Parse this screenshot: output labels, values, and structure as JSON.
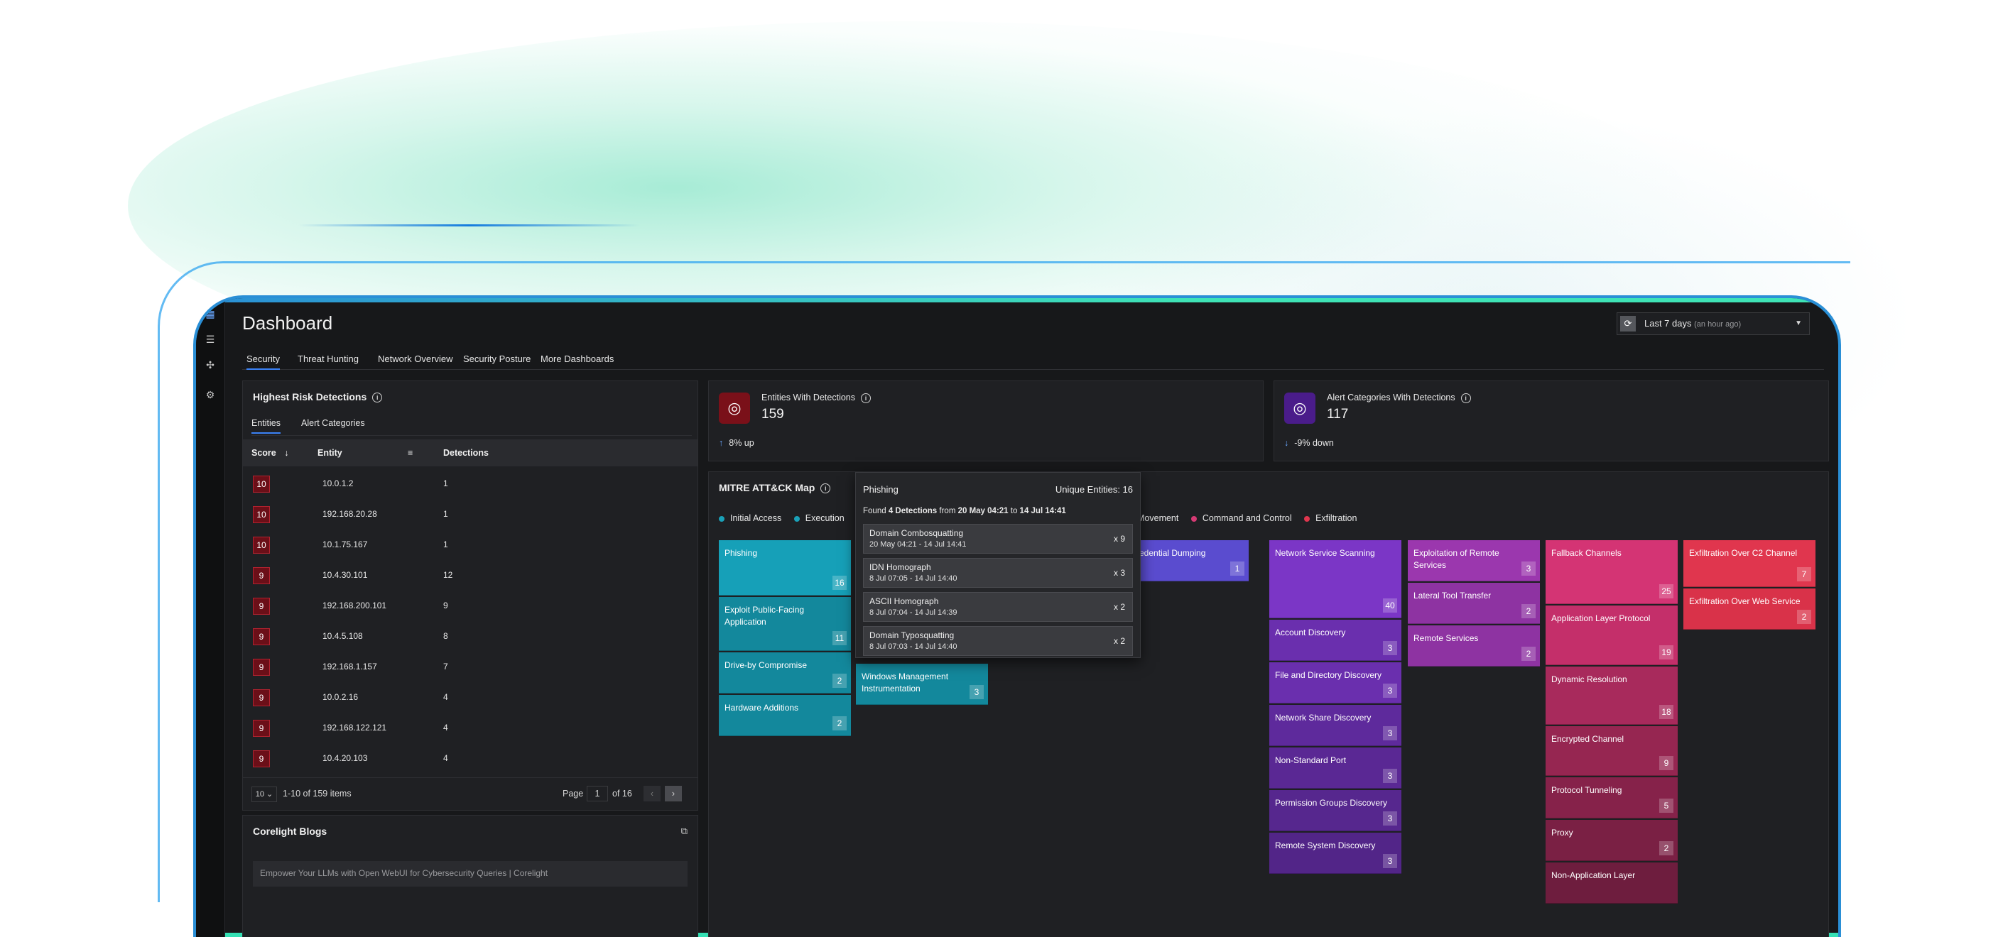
{
  "page": {
    "title": "Dashboard"
  },
  "time_range": {
    "label": "Last 7 days",
    "sub": "(an hour ago)"
  },
  "tabs": [
    "Security",
    "Threat Hunting",
    "Network Overview",
    "Security Posture",
    "More Dashboards"
  ],
  "risk": {
    "title": "Highest Risk Detections",
    "subtabs": [
      "Entities",
      "Alert Categories"
    ],
    "columns": [
      "Score",
      "Entity",
      "Detections"
    ],
    "rows": [
      {
        "score": "10",
        "entity": "10.0.1.2",
        "detections": "1"
      },
      {
        "score": "10",
        "entity": "192.168.20.28",
        "detections": "1"
      },
      {
        "score": "10",
        "entity": "10.1.75.167",
        "detections": "1"
      },
      {
        "score": "9",
        "entity": "10.4.30.101",
        "detections": "12"
      },
      {
        "score": "9",
        "entity": "192.168.200.101",
        "detections": "9"
      },
      {
        "score": "9",
        "entity": "10.4.5.108",
        "detections": "8"
      },
      {
        "score": "9",
        "entity": "192.168.1.157",
        "detections": "7"
      },
      {
        "score": "9",
        "entity": "10.0.2.16",
        "detections": "4"
      },
      {
        "score": "9",
        "entity": "192.168.122.121",
        "detections": "4"
      },
      {
        "score": "9",
        "entity": "10.4.20.103",
        "detections": "4"
      }
    ],
    "pager": {
      "page_size": "10",
      "summary": "1-10 of 159 items",
      "page_label": "Page",
      "page": "1",
      "of": "of 16"
    }
  },
  "blogs": {
    "title": "Corelight Blogs",
    "item": "Empower Your LLMs with Open WebUI for Cybersecurity Queries | Corelight"
  },
  "kpi1": {
    "title": "Entities With Detections",
    "value": "159",
    "trend": "8% up"
  },
  "kpi2": {
    "title": "Alert Categories With Detections",
    "value": "117",
    "trend": "-9% down"
  },
  "mitre": {
    "title": "MITRE ATT&CK Map",
    "legend": [
      {
        "label": "Initial Access",
        "color": "#1aa1b8"
      },
      {
        "label": "Execution",
        "color": "#1aa1b8"
      },
      {
        "label": "Movement",
        "color": "#b03fb8"
      },
      {
        "label": "Command and Control",
        "color": "#d63a74"
      },
      {
        "label": "Exfiltration",
        "color": "#e0364e"
      }
    ],
    "col1": [
      {
        "label": "Phishing",
        "count": "16"
      },
      {
        "label": "Exploit Public-Facing Application",
        "count": "11"
      },
      {
        "label": "Drive-by Compromise",
        "count": "2"
      },
      {
        "label": "Hardware Additions",
        "count": "2"
      }
    ],
    "col2": [
      {
        "label": "Windows Management Instrumentation",
        "count": "3"
      }
    ],
    "col3": [
      {
        "label": "S Credential Dumping",
        "count": "1"
      }
    ],
    "col4": [
      {
        "label": "Network Service Scanning",
        "count": "40"
      },
      {
        "label": "Account Discovery",
        "count": "3"
      },
      {
        "label": "File and Directory Discovery",
        "count": "3"
      },
      {
        "label": "Network Share Discovery",
        "count": "3"
      },
      {
        "label": "Non-Standard Port",
        "count": "3"
      },
      {
        "label": "Permission Groups Discovery",
        "count": "3"
      },
      {
        "label": "Remote System Discovery",
        "count": "3"
      }
    ],
    "col5": [
      {
        "label": "Exploitation of Remote Services",
        "count": "3"
      },
      {
        "label": "Lateral Tool Transfer",
        "count": "2"
      },
      {
        "label": "Remote Services",
        "count": "2"
      }
    ],
    "col6": [
      {
        "label": "Fallback Channels",
        "count": "25"
      },
      {
        "label": "Application Layer Protocol",
        "count": "19"
      },
      {
        "label": "Dynamic Resolution",
        "count": "18"
      },
      {
        "label": "Encrypted Channel",
        "count": "9"
      },
      {
        "label": "Protocol Tunneling",
        "count": "5"
      },
      {
        "label": "Proxy",
        "count": "2"
      },
      {
        "label": "Non-Application Layer",
        "count": ""
      }
    ],
    "col7": [
      {
        "label": "Exfiltration Over C2 Channel",
        "count": "7"
      },
      {
        "label": "Exfiltration Over Web Service",
        "count": "2"
      }
    ]
  },
  "tooltip": {
    "title": "Phishing",
    "unique": "Unique Entities: 16",
    "found_pre": "Found ",
    "found_count": "4 Detections",
    "found_mid": " from ",
    "found_from": "20 May 04:21",
    "found_to_word": " to ",
    "found_to": "14 Jul 14:41",
    "items": [
      {
        "name": "Domain Combosquatting",
        "dates": "20 May 04:21 - 14 Jul 14:41",
        "count": "x 9"
      },
      {
        "name": "IDN Homograph",
        "dates": "8 Jul 07:05 - 14 Jul 14:40",
        "count": "x 3"
      },
      {
        "name": "ASCII Homograph",
        "dates": "8 Jul 07:04 - 14 Jul 14:39",
        "count": "x 2"
      },
      {
        "name": "Domain Typosquatting",
        "dates": "8 Jul 07:03 - 14 Jul 14:40",
        "count": "x 2"
      }
    ]
  }
}
